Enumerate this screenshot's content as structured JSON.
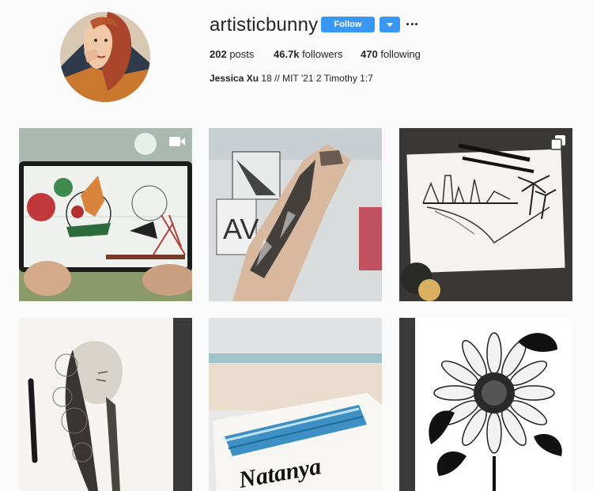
{
  "profile": {
    "username": "artisticbunny",
    "follow_label": "Follow",
    "stats": {
      "posts_value": "202",
      "posts_label": "posts",
      "followers_value": "46.7k",
      "followers_label": "followers",
      "following_value": "470",
      "following_label": "following"
    },
    "bio": {
      "full_name": "Jessica Xu",
      "text": "18 // MIT '21 2 Timothy 1:7"
    }
  },
  "icons": {
    "dropdown": "chevron-down-icon",
    "more": "more-options-icon",
    "video": "video-icon",
    "carousel": "carousel-icon"
  },
  "colors": {
    "accent": "#3897f0",
    "background": "#fafafa",
    "text": "#262626"
  },
  "posts": [
    {
      "type": "video"
    },
    {
      "type": "photo"
    },
    {
      "type": "carousel"
    },
    {
      "type": "photo"
    },
    {
      "type": "photo"
    },
    {
      "type": "photo"
    }
  ]
}
